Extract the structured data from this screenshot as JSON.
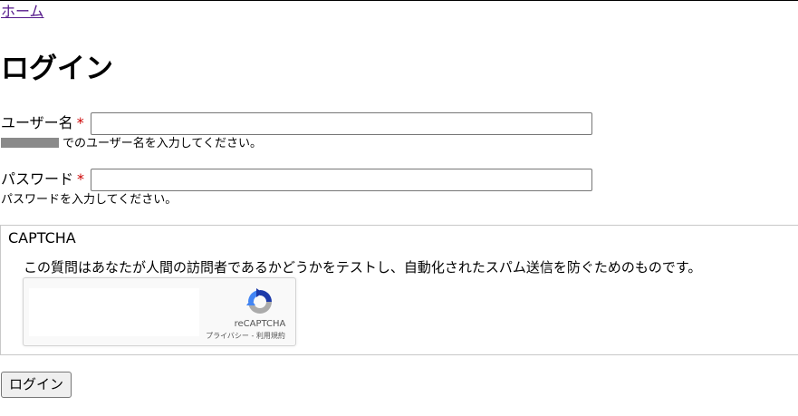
{
  "nav": {
    "home_label": "ホーム"
  },
  "page": {
    "title": "ログイン"
  },
  "form": {
    "username": {
      "label": "ユーザー名",
      "required_mark": "*",
      "value": "",
      "help_suffix": "でのユーザー名を入力してください。"
    },
    "password": {
      "label": "パスワード",
      "required_mark": "*",
      "value": "",
      "help": "パスワードを入力してください。"
    },
    "captcha": {
      "legend": "CAPTCHA",
      "description": "この質問はあなたが人間の訪問者であるかどうかをテストし、自動化されたスパム送信を防ぐためのものです。",
      "widget_brand": "reCAPTCHA",
      "widget_links": "プライバシー - 利用規約",
      "logo_icon": "recaptcha-logo-icon"
    },
    "submit_label": "ログイン"
  },
  "colors": {
    "link": "#551a8b",
    "required": "#cc0000",
    "recaptcha_blue": "#1c3aa9",
    "recaptcha_light_blue": "#4285f4",
    "recaptcha_gray": "#ababab"
  }
}
